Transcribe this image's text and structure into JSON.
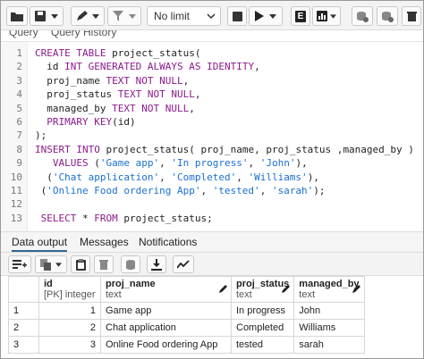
{
  "toolbar": {
    "limit_select": "No limit",
    "buttons": [
      "folder-icon",
      "save-icon",
      "edit-icon",
      "filter-icon",
      "stop-icon",
      "play-icon",
      "explain-icon",
      "explain-analyze-icon",
      "commit-icon",
      "rollback-icon"
    ],
    "explain_label": "E"
  },
  "query_tabs": {
    "query": "Query",
    "history": "Query History"
  },
  "editor": {
    "line_numbers": [
      "1",
      "2",
      "3",
      "4",
      "5",
      "6",
      "7",
      "8",
      "9",
      "10",
      "11",
      "12",
      "13"
    ],
    "lines": [
      "CREATE TABLE project_status(",
      "  id INT GENERATED ALWAYS AS IDENTITY,",
      "  proj_name TEXT NOT NULL,",
      "  proj_status TEXT NOT NULL,",
      "  managed_by TEXT NOT NULL,",
      "  PRIMARY KEY(id)",
      ");",
      "INSERT INTO project_status( proj_name, proj_status ,managed_by )",
      "   VALUES ('Game app', 'In progress', 'John'),",
      "  ('Chat application', 'Completed', 'Williams'),",
      " ('Online Food ordering App', 'tested', 'sarah');",
      "",
      " SELECT * FROM project_status;"
    ]
  },
  "result_tabs": [
    "Data output",
    "Messages",
    "Notifications"
  ],
  "grid": {
    "columns": [
      {
        "name": "id",
        "type": "[PK] integer"
      },
      {
        "name": "proj_name",
        "type": "text"
      },
      {
        "name": "proj_status",
        "type": "text"
      },
      {
        "name": "managed_by",
        "type": "text"
      }
    ],
    "rows": [
      {
        "row": "1",
        "id": "1",
        "proj_name": "Game app",
        "proj_status": "In progress",
        "managed_by": "John"
      },
      {
        "row": "2",
        "id": "2",
        "proj_name": "Chat application",
        "proj_status": "Completed",
        "managed_by": "Williams"
      },
      {
        "row": "3",
        "id": "3",
        "proj_name": "Online Food ordering App",
        "proj_status": "tested",
        "managed_by": "sarah"
      }
    ]
  },
  "colors": {
    "keyword": "#8b1a8b",
    "string": "#1a6fd1",
    "active_tab": "#326690"
  }
}
